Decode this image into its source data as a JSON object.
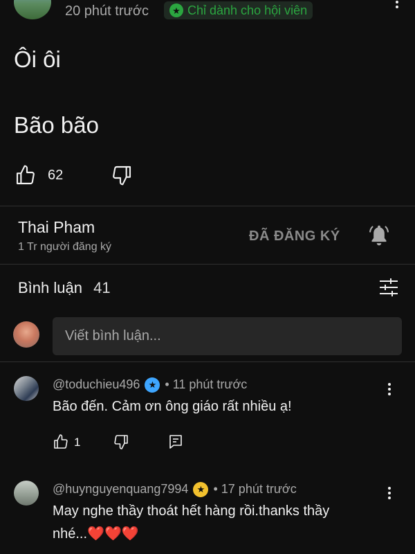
{
  "post": {
    "time": "20 phút trước",
    "members_badge": "Chỉ dành cho hội viên",
    "line1": "Ôi ôi",
    "line2": "Bão bão",
    "likes": "62"
  },
  "channel": {
    "name": "Thai Pham",
    "subscribers": "1 Tr người đăng ký",
    "subscribed_label": "ĐÃ ĐĂNG KÝ"
  },
  "comments_section": {
    "title": "Bình luận",
    "count": "41",
    "input_placeholder": "Viết bình luận..."
  },
  "comments": [
    {
      "handle": "@toduchieu496",
      "badge_color": "#3ea6ff",
      "time": "• 11 phút trước",
      "text": "Bão đến. Cảm ơn ông giáo rất nhiều ạ!",
      "likes": "1"
    },
    {
      "handle": "@huynguyenquang7994",
      "badge_color": "#f2c12e",
      "time": "• 17 phút trước",
      "text": "May nghe thầy thoát hết hàng rồi.thanks thầy",
      "text2": "nhé...❤️❤️❤️"
    }
  ],
  "icons": {
    "like": "thumb-up-icon",
    "dislike": "thumb-down-icon",
    "bell": "bell-icon",
    "filter": "sort-filter-icon",
    "reply": "reply-icon",
    "more": "more-vert-icon"
  }
}
